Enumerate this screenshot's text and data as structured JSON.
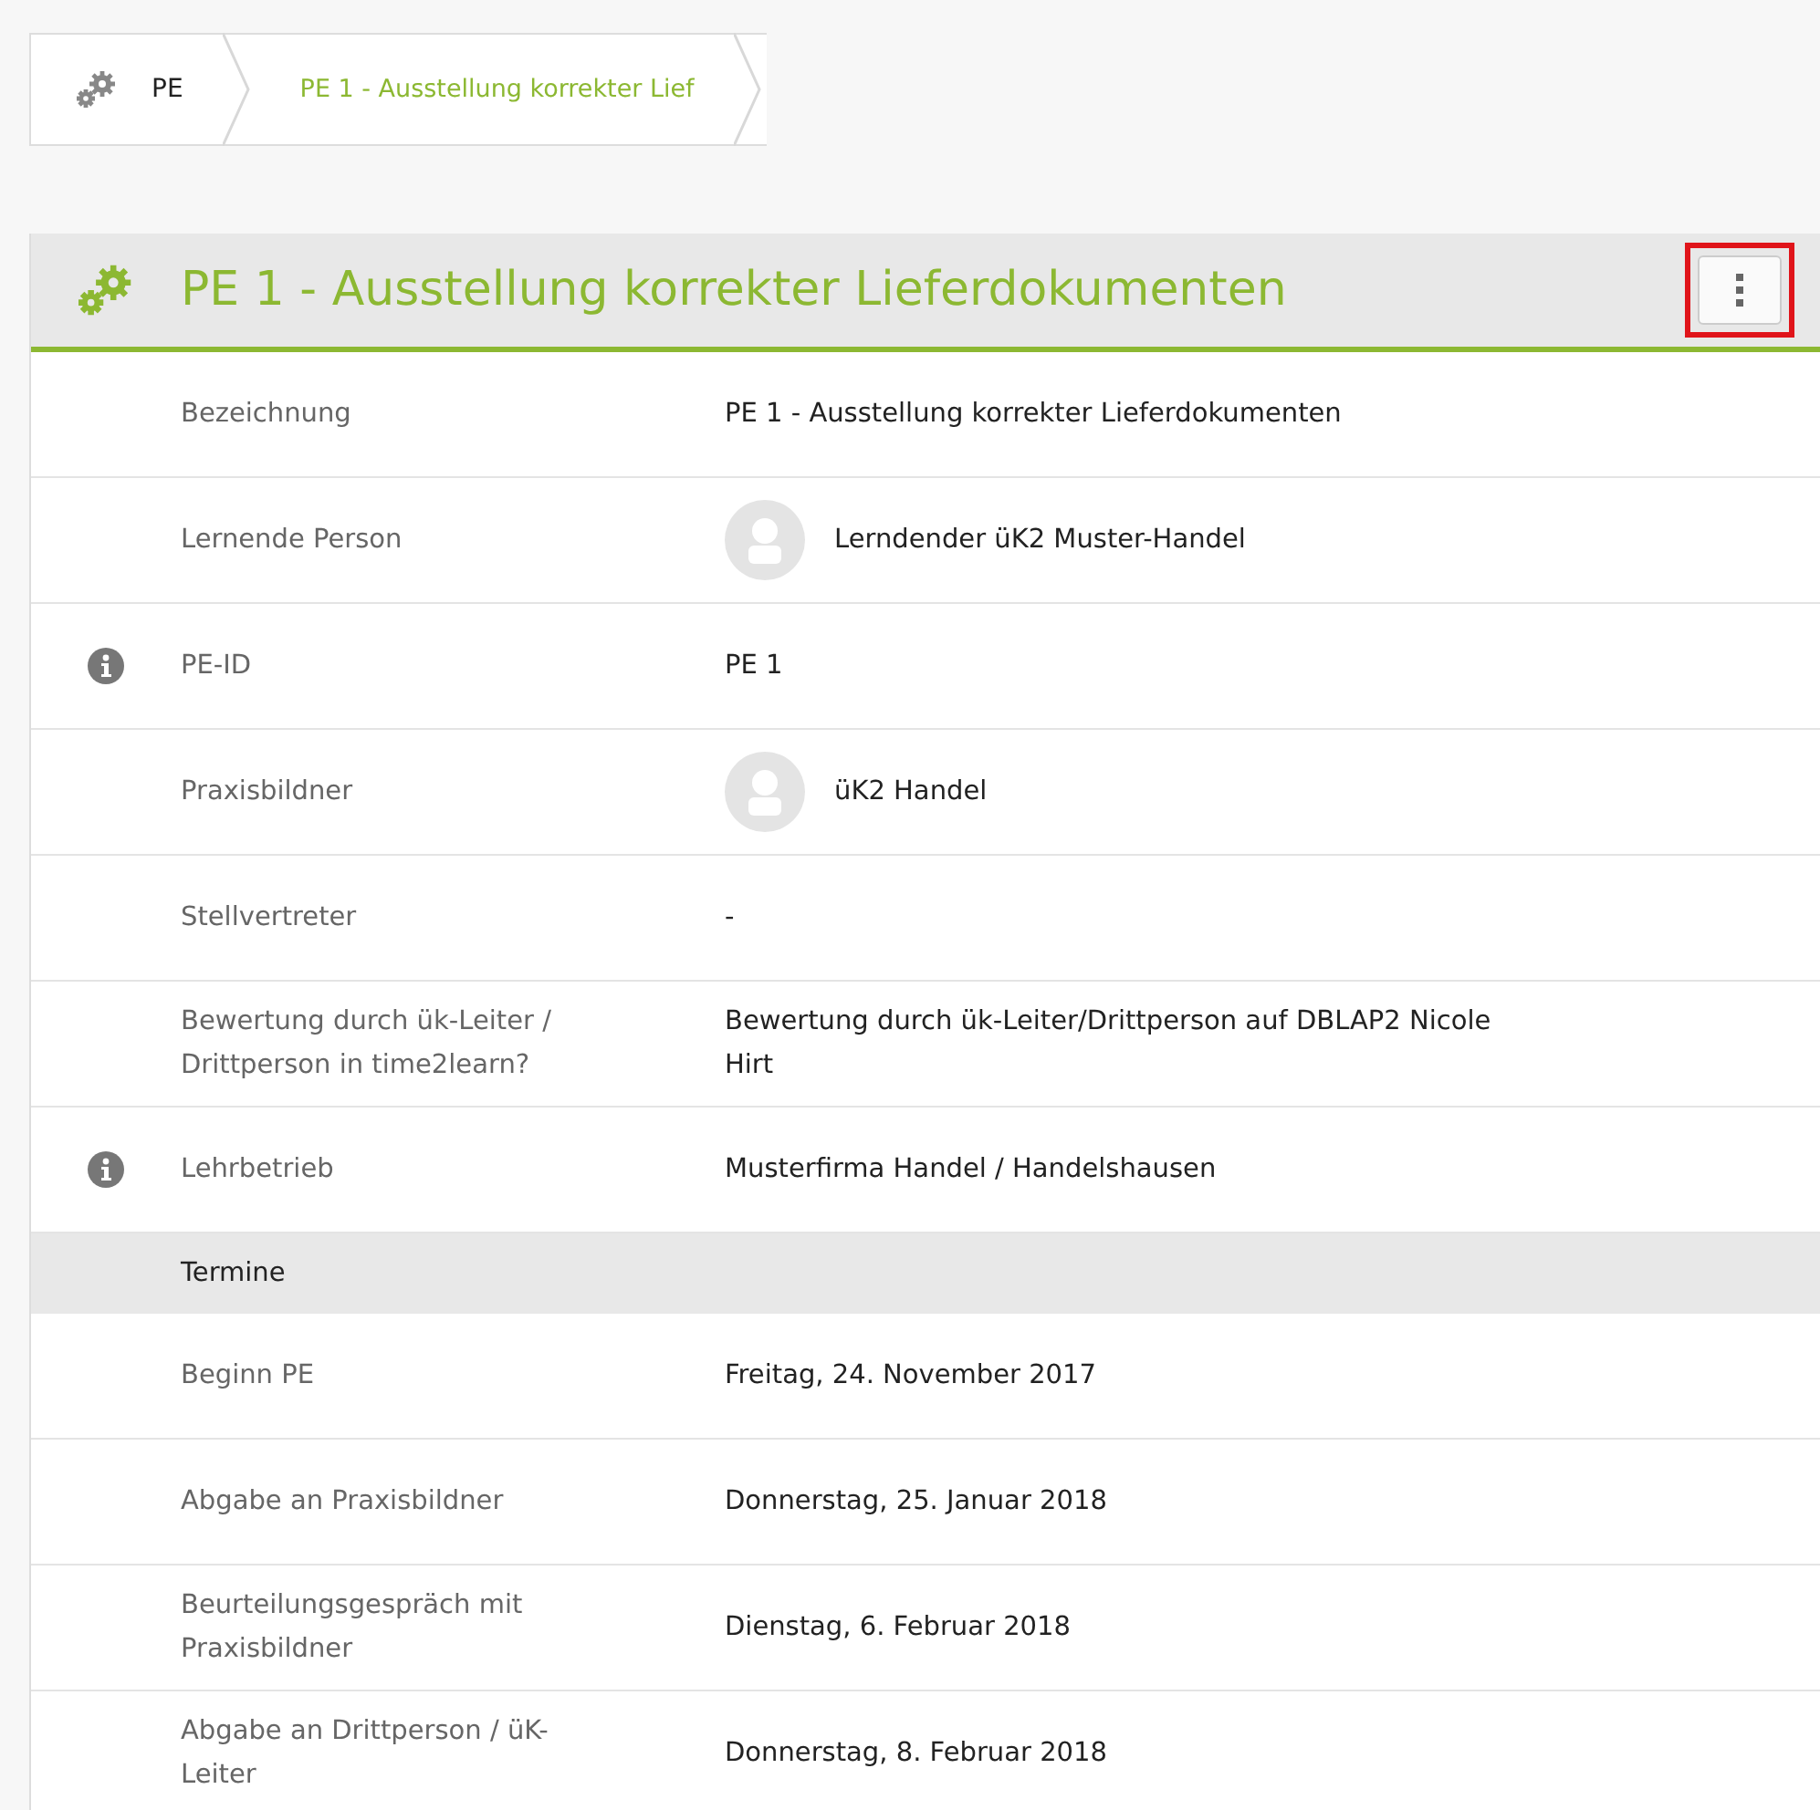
{
  "breadcrumb": [
    {
      "label": "PE",
      "icon": true,
      "selected": false
    },
    {
      "label": "PE 1 - Ausstellung korrekter Lief",
      "icon": false,
      "selected": true
    }
  ],
  "panel": {
    "title": "PE 1 - Ausstellung korrekter Lieferdokumenten",
    "menu_button": {
      "highlighted": true
    }
  },
  "rows": [
    {
      "kind": "field",
      "label": "Bezeichnung",
      "value": "PE 1 - Ausstellung korrekter Lieferdokumenten",
      "info": false
    },
    {
      "kind": "person",
      "label": "Lernende Person",
      "value": "Lerndender üK2 Muster-Handel",
      "info": false
    },
    {
      "kind": "field",
      "label": "PE-ID",
      "value": "PE 1",
      "info": true
    },
    {
      "kind": "person",
      "label": "Praxisbildner",
      "value": "üK2 Handel",
      "info": false
    },
    {
      "kind": "field",
      "label": "Stellvertreter",
      "value": "-",
      "info": false
    },
    {
      "kind": "field",
      "label": "Bewertung durch ük-Leiter / Drittperson in time2learn?",
      "value": "Bewertung durch ük-Leiter/Drittperson auf DBLAP2 Nicole Hirt",
      "info": false
    },
    {
      "kind": "field",
      "label": "Lehrbetrieb",
      "value": "Musterfirma Handel / Handelshausen",
      "info": true
    },
    {
      "kind": "section",
      "label": "Termine"
    },
    {
      "kind": "field",
      "label": "Beginn PE",
      "value": "Freitag, 24. November 2017",
      "info": false
    },
    {
      "kind": "field",
      "label": "Abgabe an Praxisbildner",
      "value": "Donnerstag, 25. Januar 2018",
      "info": false
    },
    {
      "kind": "field",
      "label": "Beurteilungsgespräch mit Praxisbildner",
      "value": "Dienstag, 6. Februar 2018",
      "info": false
    },
    {
      "kind": "field",
      "label": "Abgabe an Drittperson / üK-Leiter",
      "value": "Donnerstag, 8. Februar 2018",
      "info": false
    }
  ]
}
